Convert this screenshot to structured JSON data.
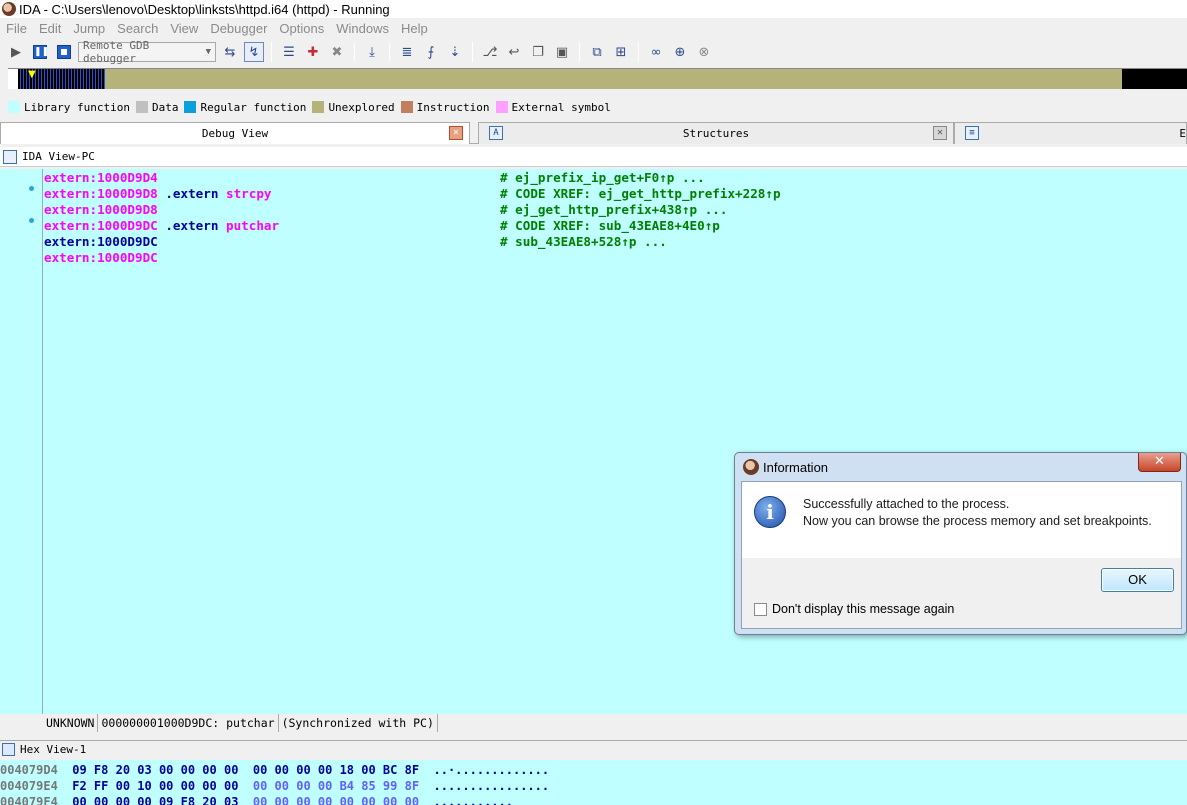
{
  "window": {
    "title": "IDA - C:\\Users\\lenovo\\Desktop\\linksts\\httpd.i64 (httpd) - Running"
  },
  "menu": [
    "File",
    "Edit",
    "Jump",
    "Search",
    "View",
    "Debugger",
    "Options",
    "Windows",
    "Help"
  ],
  "toolbar": {
    "debugger_select": "Remote GDB debugger"
  },
  "legend": [
    {
      "label": "Library function",
      "color": "#c0ffff"
    },
    {
      "label": "Data",
      "color": "#c0c0c0"
    },
    {
      "label": "Regular function",
      "color": "#0aa0e0"
    },
    {
      "label": "Unexplored",
      "color": "#b5b37a"
    },
    {
      "label": "Instruction",
      "color": "#c08060"
    },
    {
      "label": "External symbol",
      "color": "#ffa0ff"
    }
  ],
  "tabs": {
    "debug_view": "Debug View",
    "structures": "Structures",
    "third": "E"
  },
  "ida_view": {
    "title": "IDA View-PC",
    "lines": [
      {
        "addr": "extern:1000D9D4",
        "directive": "",
        "symbol": "",
        "comment": "# ej_prefix_ip_get+F0↑p ..."
      },
      {
        "addr": "extern:1000D9D8",
        "directive": ".extern",
        "symbol": "strcpy",
        "comment": "# CODE XREF: ej_get_http_prefix+228↑p"
      },
      {
        "addr": "extern:1000D9D8",
        "directive": "",
        "symbol": "",
        "comment": "# ej_get_http_prefix+438↑p ..."
      },
      {
        "addr": "extern:1000D9DC",
        "directive": ".extern",
        "symbol": "putchar",
        "comment": "# CODE XREF: sub_43EAE8+4E0↑p"
      },
      {
        "addr": "extern:1000D9DC",
        "directive": "",
        "symbol": "",
        "comment": "# sub_43EAE8+528↑p ..."
      },
      {
        "addr": "extern:1000D9DC",
        "directive": "",
        "symbol": "",
        "comment": ""
      }
    ],
    "status": {
      "segment": "UNKNOWN",
      "location": "000000001000D9DC: putchar",
      "sync": "(Synchronized with PC)"
    }
  },
  "hex_view": {
    "title": "Hex View-1",
    "rows": [
      {
        "addr": "004079D4",
        "bytes_a": "09 F8 20 03 00 00 00 00",
        "bytes_b": "00 00 00 00 18 00 BC 8F",
        "ascii": "..·............."
      },
      {
        "addr": "004079E4",
        "bytes_a": "F2 FF 00 10 00 00 00 00",
        "bytes_b": "00 00 00 00 B4 85 99 8F",
        "ascii": "................"
      },
      {
        "addr": "004079F4",
        "bytes_a": "00 00 00 00 09 F8 20 03",
        "bytes_b": "00 00 00 00 00 00 00 00",
        "ascii": "..........."
      }
    ]
  },
  "dialog": {
    "title": "Information",
    "close": "✕",
    "message_line1": "Successfully attached to the process.",
    "message_line2": "Now you can browse the process memory and set breakpoints.",
    "ok": "OK",
    "checkbox": "Don't display this message again"
  }
}
